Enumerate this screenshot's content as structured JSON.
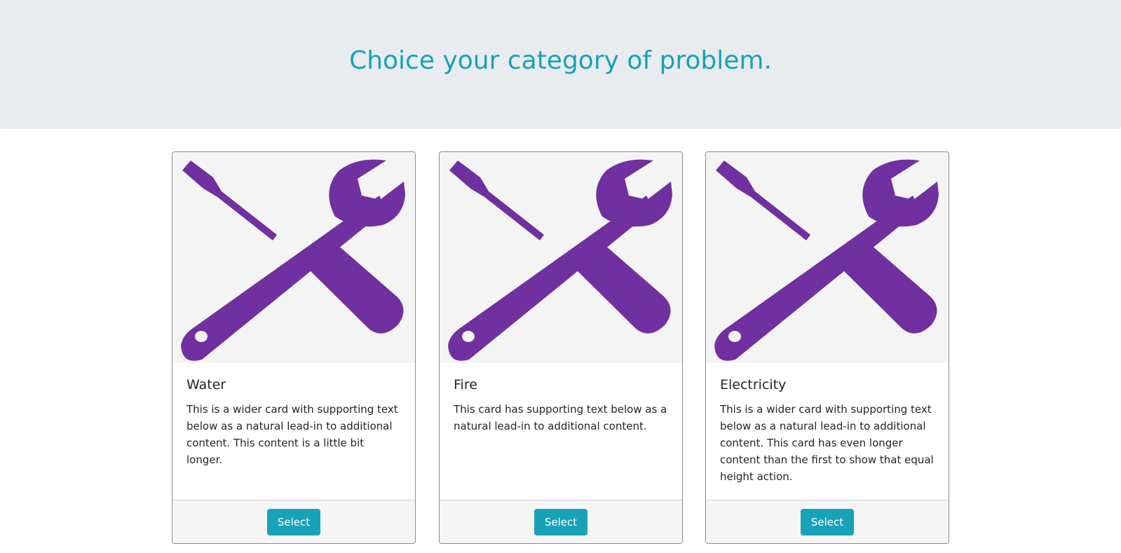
{
  "header": {
    "title": "Choice your category of problem."
  },
  "colors": {
    "accent": "#17a2b8",
    "jumbotron_bg": "#e9ecef",
    "tools_icon": "#7030a0",
    "image_bg": "#f4f4f5"
  },
  "cards": [
    {
      "image_icon": "tools-icon",
      "title": "Water",
      "text": "This is a wider card with supporting text below as a natural lead-in to additional content. This content is a little bit longer.",
      "button_label": "Select"
    },
    {
      "image_icon": "tools-icon",
      "title": "Fire",
      "text": "This card has supporting text below as a natural lead-in to additional content.",
      "button_label": "Select"
    },
    {
      "image_icon": "tools-icon",
      "title": "Electricity",
      "text": "This is a wider card with supporting text below as a natural lead-in to additional content. This card has even longer content than the first to show that equal height action.",
      "button_label": "Select"
    }
  ]
}
